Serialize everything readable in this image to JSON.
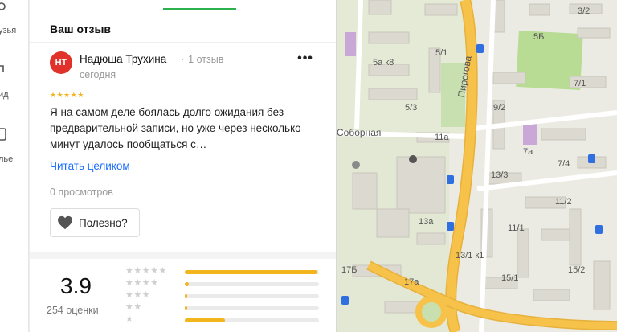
{
  "rail": {
    "items": [
      {
        "label": "узья",
        "icon": "friends-icon"
      },
      {
        "label": "ид",
        "icon": "guide-icon"
      },
      {
        "label": "лье",
        "icon": "portfolio-icon"
      }
    ]
  },
  "review": {
    "section_title": "Ваш отзыв",
    "avatar_initials": "НТ",
    "author": "Надюша Трухина",
    "author_reviews": "1 отзыв",
    "date": "сегодня",
    "stars": "★★★★★",
    "text": "Я на самом деле боялась долго ожидания без предварительной записи, но уже через несколько минут удалось пообщаться с…",
    "read_more": "Читать целиком",
    "views": "0 просмотров",
    "helpful_label": "Полезно?",
    "more_label": "•••"
  },
  "rating": {
    "score": "3.9",
    "count": "254 оценки",
    "rows": [
      {
        "stars": "★★★★★",
        "fraction": 0.99
      },
      {
        "stars": "★★★★",
        "fraction": 0.03
      },
      {
        "stars": "★★★",
        "fraction": 0.02
      },
      {
        "stars": "★★",
        "fraction": 0.02
      },
      {
        "stars": "★",
        "fraction": 0.3
      }
    ]
  },
  "map": {
    "labels": {
      "l1": "3/2",
      "l2": "5Б",
      "l3": "5а к8",
      "l4": "5/1",
      "l5": "7/1",
      "l6": "5/3",
      "l7": "9/2",
      "l8": "Пирогова",
      "l9": "Соборная",
      "l10": "11а",
      "l11": "7а",
      "l12": "7/4",
      "l13": "13/3",
      "l14": "11/2",
      "l15": "13а",
      "l16": "11/1",
      "l17": "13/1 к1",
      "l18": "15/2",
      "l19": "15/1",
      "l20": "17Б",
      "l21": "17а"
    }
  },
  "colors": {
    "accent_green": "#2bb24c",
    "star_yellow": "#f2b51d",
    "link_blue": "#196dff",
    "avatar_red": "#e0312a",
    "road_orange": "#f6c24a"
  }
}
